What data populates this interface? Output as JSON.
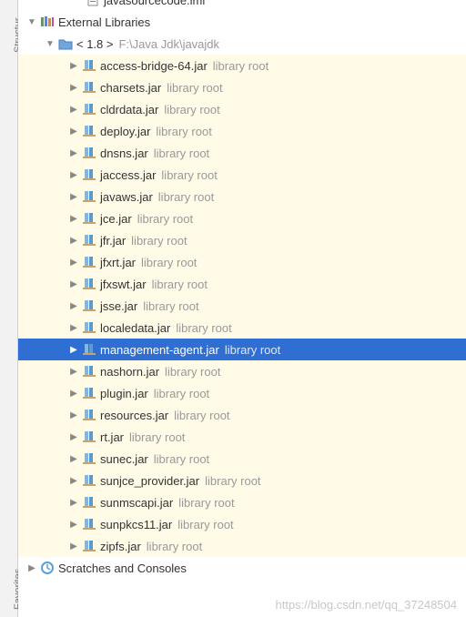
{
  "sidebar": {
    "tabs": {
      "structure": "Structur",
      "favorites": "Favorites"
    }
  },
  "tree": {
    "topfile": "javasourcecode.iml",
    "external_label": "External Libraries",
    "jdk": {
      "prefix": "< 1.8 >",
      "path": "F:\\Java Jdk\\javajdk"
    },
    "suffix": "library root",
    "jars": [
      {
        "name": "access-bridge-64.jar",
        "selected": false
      },
      {
        "name": "charsets.jar",
        "selected": false
      },
      {
        "name": "cldrdata.jar",
        "selected": false
      },
      {
        "name": "deploy.jar",
        "selected": false
      },
      {
        "name": "dnsns.jar",
        "selected": false
      },
      {
        "name": "jaccess.jar",
        "selected": false
      },
      {
        "name": "javaws.jar",
        "selected": false
      },
      {
        "name": "jce.jar",
        "selected": false
      },
      {
        "name": "jfr.jar",
        "selected": false
      },
      {
        "name": "jfxrt.jar",
        "selected": false
      },
      {
        "name": "jfxswt.jar",
        "selected": false
      },
      {
        "name": "jsse.jar",
        "selected": false
      },
      {
        "name": "localedata.jar",
        "selected": false
      },
      {
        "name": "management-agent.jar",
        "selected": true
      },
      {
        "name": "nashorn.jar",
        "selected": false
      },
      {
        "name": "plugin.jar",
        "selected": false
      },
      {
        "name": "resources.jar",
        "selected": false
      },
      {
        "name": "rt.jar",
        "selected": false
      },
      {
        "name": "sunec.jar",
        "selected": false
      },
      {
        "name": "sunjce_provider.jar",
        "selected": false
      },
      {
        "name": "sunmscapi.jar",
        "selected": false
      },
      {
        "name": "sunpkcs11.jar",
        "selected": false
      },
      {
        "name": "zipfs.jar",
        "selected": false
      }
    ],
    "scratches_label": "Scratches and Consoles"
  },
  "watermark": "https://blog.csdn.net/qq_37248504"
}
